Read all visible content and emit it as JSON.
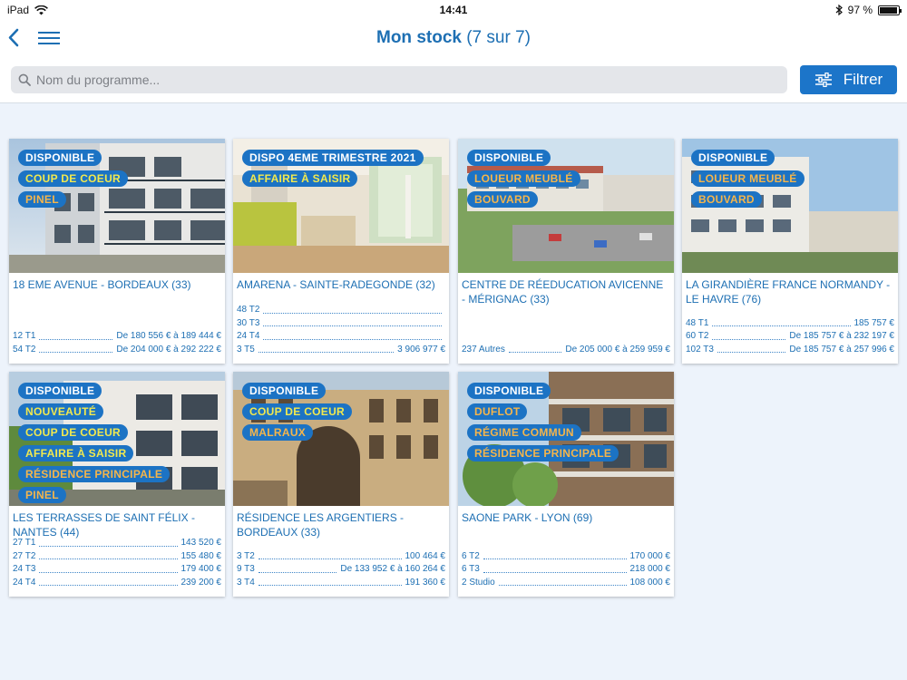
{
  "status_bar": {
    "device": "iPad",
    "time": "14:41",
    "battery": "97 %",
    "battery_level": 0.97
  },
  "nav": {
    "title": "Mon stock",
    "count": "(7 sur 7)"
  },
  "search": {
    "placeholder": "Nom du programme...",
    "value": ""
  },
  "filter_button": {
    "label": "Filtrer"
  },
  "colors": {
    "brand_blue": "#1c73c4",
    "tag_white": "#ffffff",
    "tag_yellow": "#f2e94e",
    "tag_orange": "#f5b54b"
  },
  "programs": [
    {
      "tags": [
        {
          "label": "DISPONIBLE",
          "color": "white"
        },
        {
          "label": "COUP DE COEUR",
          "color": "yellow"
        },
        {
          "label": "PINEL",
          "color": "orange"
        }
      ],
      "title": "18 EME AVENUE  -  BORDEAUX  (33)",
      "lots": [
        {
          "type": "12 T1",
          "price": "De 180 556 € à 189 444 €"
        },
        {
          "type": "54 T2",
          "price": "De 204 000 € à 292 222 €"
        }
      ]
    },
    {
      "tags": [
        {
          "label": "DISPO 4EME TRIMESTRE 2021",
          "color": "white"
        },
        {
          "label": "AFFAIRE À SAISIR",
          "color": "yellow"
        }
      ],
      "title": "AMARENA  -  SAINTE-RADEGONDE  (32)",
      "lots": [
        {
          "type": "48 T2",
          "price": ""
        },
        {
          "type": "30 T3",
          "price": ""
        },
        {
          "type": "24 T4",
          "price": ""
        },
        {
          "type": "3 T5",
          "price": "3 906 977 €"
        }
      ]
    },
    {
      "tags": [
        {
          "label": "DISPONIBLE",
          "color": "white"
        },
        {
          "label": "LOUEUR MEUBLÉ",
          "color": "orange"
        },
        {
          "label": "BOUVARD",
          "color": "orange"
        }
      ],
      "title": "CENTRE DE RÉEDUCATION AVICENNE  -  MÉRIGNAC  (33)",
      "lots": [
        {
          "type": "237 Autres",
          "price": "De 205 000 € à 259 959 €"
        }
      ]
    },
    {
      "tags": [
        {
          "label": "DISPONIBLE",
          "color": "white"
        },
        {
          "label": "LOUEUR MEUBLÉ",
          "color": "orange"
        },
        {
          "label": "BOUVARD",
          "color": "orange"
        }
      ],
      "title": "LA GIRANDIÈRE FRANCE NORMANDY  -  LE HAVRE  (76)",
      "lots": [
        {
          "type": "48 T1",
          "price": "185 757 €"
        },
        {
          "type": "60 T2",
          "price": "De 185 757 € à 232 197 €"
        },
        {
          "type": "102 T3",
          "price": "De 185 757 € à 257 996 €"
        }
      ]
    },
    {
      "tags": [
        {
          "label": "DISPONIBLE",
          "color": "white"
        },
        {
          "label": "NOUVEAUTÉ",
          "color": "yellow"
        },
        {
          "label": "COUP DE COEUR",
          "color": "yellow"
        },
        {
          "label": "AFFAIRE À SAISIR",
          "color": "yellow"
        },
        {
          "label": "RÉSIDENCE PRINCIPALE",
          "color": "orange"
        },
        {
          "label": "PINEL",
          "color": "orange"
        }
      ],
      "title": "LES TERRASSES DE SAINT FÉLIX  -  NANTES  (44)",
      "lots": [
        {
          "type": "27 T1",
          "price": "143 520 €"
        },
        {
          "type": "27 T2",
          "price": "155 480 €"
        },
        {
          "type": "24 T3",
          "price": "179 400 €"
        },
        {
          "type": "24 T4",
          "price": "239 200 €"
        }
      ]
    },
    {
      "tags": [
        {
          "label": "DISPONIBLE",
          "color": "white"
        },
        {
          "label": "COUP DE COEUR",
          "color": "yellow"
        },
        {
          "label": "MALRAUX",
          "color": "orange"
        }
      ],
      "title": "RÉSIDENCE LES ARGENTIERS  -  BORDEAUX  (33)",
      "lots": [
        {
          "type": "3 T2",
          "price": "100 464 €"
        },
        {
          "type": "9 T3",
          "price": "De 133 952 € à 160 264 €"
        },
        {
          "type": "3 T4",
          "price": "191 360 €"
        }
      ]
    },
    {
      "tags": [
        {
          "label": "DISPONIBLE",
          "color": "white"
        },
        {
          "label": "DUFLOT",
          "color": "orange"
        },
        {
          "label": "RÉGIME COMMUN",
          "color": "orange"
        },
        {
          "label": "RÉSIDENCE PRINCIPALE",
          "color": "orange"
        }
      ],
      "title": "SAONE PARK  -  LYON  (69)",
      "lots": [
        {
          "type": "6 T2",
          "price": "170 000 €"
        },
        {
          "type": "6 T3",
          "price": "218 000 €"
        },
        {
          "type": "2 Studio",
          "price": "108 000 €"
        }
      ]
    }
  ]
}
